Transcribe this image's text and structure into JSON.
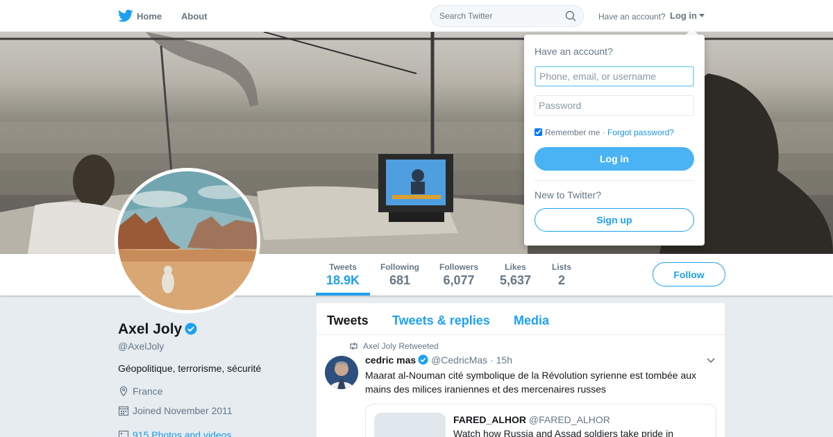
{
  "nav": {
    "home_label": "Home",
    "about_label": "About",
    "search_placeholder": "Search Twitter",
    "have_account": "Have an account?",
    "login_label": "Log in",
    "icons": [
      "twitter-bird-icon",
      "search-icon",
      "caret-down-icon"
    ]
  },
  "profile": {
    "name": "Axel Joly",
    "handle": "@AxelJoly",
    "bio": "Géopolitique, terrorisme, sécurité",
    "location": "France",
    "joined": "Joined November 2011",
    "photos": "915 Photos and videos"
  },
  "stats": [
    {
      "label": "Tweets",
      "value": "18.9K"
    },
    {
      "label": "Following",
      "value": "681"
    },
    {
      "label": "Followers",
      "value": "6,077"
    },
    {
      "label": "Likes",
      "value": "5,637"
    },
    {
      "label": "Lists",
      "value": "2"
    }
  ],
  "follow_label": "Follow",
  "tabs": [
    "Tweets",
    "Tweets & replies",
    "Media"
  ],
  "tweet": {
    "context": "Axel Joly Retweeted",
    "name": "cedric mas",
    "handle": "@CedricMas",
    "dot": "·",
    "time": "15h",
    "text": "Maarat al-Nouman cité symbolique de la Révolution syrienne est tombée aux mains des milices iraniennes et des mercenaires russes",
    "quote": {
      "name": "FARED_ALHOR",
      "handle": "@FARED_ALHOR",
      "text": "Watch how Russia and Assad soldiers take pride in"
    }
  },
  "login_dropdown": {
    "title": "Have an account?",
    "username_placeholder": "Phone, email, or username",
    "password_placeholder": "Password",
    "remember": "Remember me",
    "separator": "·",
    "forgot": "Forgot password?",
    "login_button": "Log in",
    "new_prompt": "New to Twitter?",
    "signup_button": "Sign up"
  },
  "colors": {
    "accent": "#1da1f2",
    "background": "#e6ecf0",
    "login_button": "#4ab3f4"
  }
}
